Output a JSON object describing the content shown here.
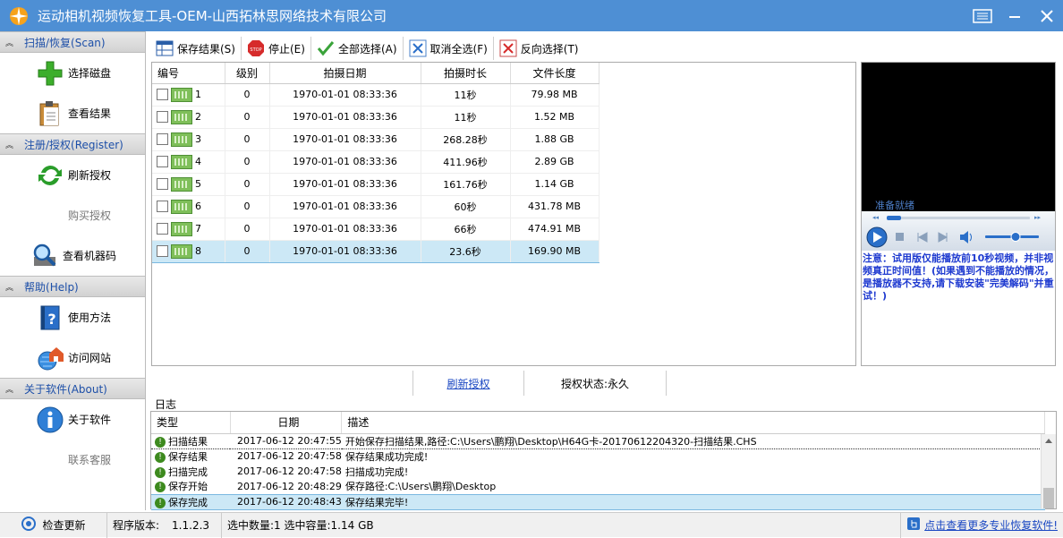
{
  "window": {
    "title": "运动相机视频恢复工具-OEM-山西拓林思网络技术有限公司"
  },
  "sidebar": {
    "sections": [
      {
        "header": "扫描/恢复(Scan)",
        "items": [
          {
            "label": "选择磁盘",
            "icon": "plus-icon"
          },
          {
            "label": "查看结果",
            "icon": "clipboard-icon"
          }
        ]
      },
      {
        "header": "注册/授权(Register)",
        "items": [
          {
            "label": "刷新授权",
            "icon": "refresh-icon"
          },
          {
            "label": "购买授权",
            "icon": ""
          },
          {
            "label": "查看机器码",
            "icon": "magnifier-icon"
          }
        ]
      },
      {
        "header": "帮助(Help)",
        "items": [
          {
            "label": "使用方法",
            "icon": "help-book-icon"
          },
          {
            "label": "访问网站",
            "icon": "globe-home-icon"
          }
        ]
      },
      {
        "header": "关于软件(About)",
        "items": [
          {
            "label": "关于软件",
            "icon": "info-icon"
          },
          {
            "label": "联系客服",
            "icon": ""
          }
        ]
      }
    ]
  },
  "toolbar": {
    "save_label": "保存结果(S)",
    "stop_label": "停止(E)",
    "select_all_label": "全部选择(A)",
    "deselect_all_label": "取消全选(F)",
    "invert_label": "反向选择(T)"
  },
  "table": {
    "columns": [
      "编号",
      "级别",
      "拍摄日期",
      "拍摄时长",
      "文件长度"
    ],
    "rows": [
      {
        "id": "1",
        "level": "0",
        "date": "1970-01-01 08:33:36",
        "duration": "11秒",
        "size": "79.98 MB"
      },
      {
        "id": "2",
        "level": "0",
        "date": "1970-01-01 08:33:36",
        "duration": "11秒",
        "size": "1.52 MB"
      },
      {
        "id": "3",
        "level": "0",
        "date": "1970-01-01 08:33:36",
        "duration": "268.28秒",
        "size": "1.88 GB"
      },
      {
        "id": "4",
        "level": "0",
        "date": "1970-01-01 08:33:36",
        "duration": "411.96秒",
        "size": "2.89 GB"
      },
      {
        "id": "5",
        "level": "0",
        "date": "1970-01-01 08:33:36",
        "duration": "161.76秒",
        "size": "1.14 GB"
      },
      {
        "id": "6",
        "level": "0",
        "date": "1970-01-01 08:33:36",
        "duration": "60秒",
        "size": "431.78 MB"
      },
      {
        "id": "7",
        "level": "0",
        "date": "1970-01-01 08:33:36",
        "duration": "66秒",
        "size": "474.91 MB"
      },
      {
        "id": "8",
        "level": "0",
        "date": "1970-01-01 08:33:36",
        "duration": "23.6秒",
        "size": "169.90 MB"
      }
    ]
  },
  "player": {
    "status": "准备就绪",
    "notice": "注意：试用版仅能播放前10秒视频，并非视频真正时间值！(如果遇到不能播放的情况，是播放器不支持,请下载安装\"完美解码\"并重试！)"
  },
  "midbar": {
    "refresh_link": "刷新授权",
    "license_status": "授权状态:永久"
  },
  "log": {
    "label": "日志",
    "columns": [
      "类型",
      "日期",
      "描述"
    ],
    "rows": [
      {
        "type": "扫描结果",
        "date": "2017-06-12 20:47:55",
        "desc": "开始保存扫描结果,路径:C:\\Users\\鹏翔\\Desktop\\H64G卡-20170612204320-扫描结果.CHS"
      },
      {
        "type": "保存结果",
        "date": "2017-06-12 20:47:58",
        "desc": "保存结果成功完成!"
      },
      {
        "type": "扫描完成",
        "date": "2017-06-12 20:47:58",
        "desc": "扫描成功完成!"
      },
      {
        "type": "保存开始",
        "date": "2017-06-12 20:48:29",
        "desc": "保存路径:C:\\Users\\鹏翔\\Desktop"
      },
      {
        "type": "保存完成",
        "date": "2017-06-12 20:48:43",
        "desc": "保存结果完毕!"
      }
    ]
  },
  "statusbar": {
    "update_label": "检查更新",
    "version_label": "程序版本:",
    "version": "1.1.2.3",
    "selection": "选中数量:1 选中容量:1.14 GB",
    "promo_link": "点击查看更多专业恢复软件!"
  }
}
